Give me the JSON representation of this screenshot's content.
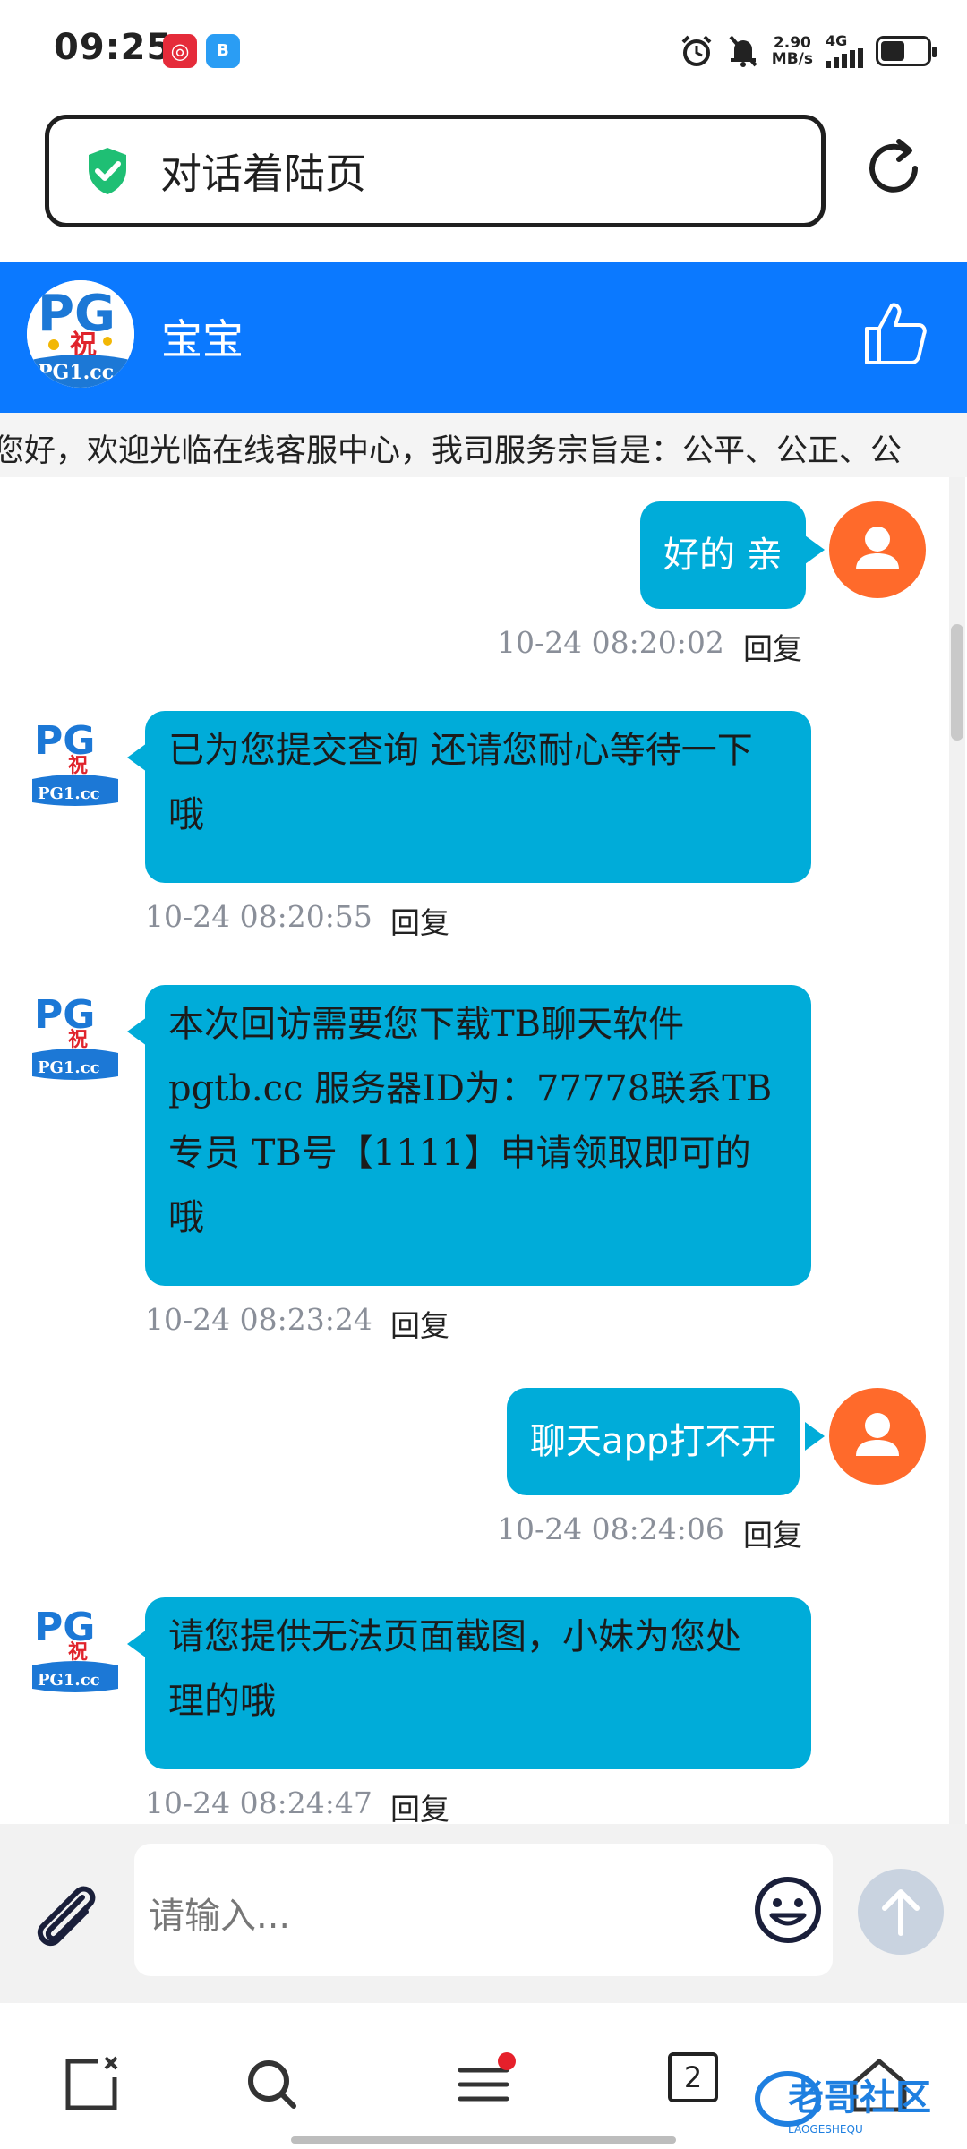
{
  "status_bar": {
    "time": "09:25",
    "net_speed_value": "2.90",
    "net_speed_unit": "MB/s",
    "network": "4G"
  },
  "address_bar": {
    "title": "对话着陆页"
  },
  "chat_header": {
    "agent_name": "宝宝",
    "avatar_text": "PG",
    "avatar_domain": "PG1.cc"
  },
  "marquee": {
    "text": "您好，欢迎光临在线客服中心，我司服务宗旨是：公平、公正、公"
  },
  "messages": [
    {
      "from": "user",
      "text": "好的 亲",
      "time": "10-24 08:20:02",
      "reply": "回复"
    },
    {
      "from": "agent",
      "lines": [
        "已为您提交查询 还请您耐心等待一下",
        "哦"
      ],
      "time": "10-24 08:20:55",
      "reply": "回复"
    },
    {
      "from": "agent",
      "lines": [
        "本次回访需要您下载TB聊天软件",
        "pgtb.cc 服务器ID为：77778联系TB",
        "专员 TB号【1111】申请领取即可的",
        "哦"
      ],
      "time": "10-24 08:23:24",
      "reply": "回复"
    },
    {
      "from": "user",
      "text": "聊天app打不开",
      "time": "10-24 08:24:06",
      "reply": "回复"
    },
    {
      "from": "agent",
      "lines": [
        "请您提供无法页面截图，小妹为您处",
        "理的哦"
      ],
      "time": "10-24 08:24:47",
      "reply": "回复"
    }
  ],
  "input": {
    "placeholder": "请输入..."
  },
  "bottom_nav": {
    "tab_count": "2"
  },
  "watermark": {
    "text": "老哥社区",
    "sub": "LAOGESHEQU"
  },
  "colors": {
    "header_blue": "#0b79ff",
    "bubble": "#00acd9",
    "user_avatar": "#ff6a2b",
    "timestamp": "#8a8f99"
  }
}
